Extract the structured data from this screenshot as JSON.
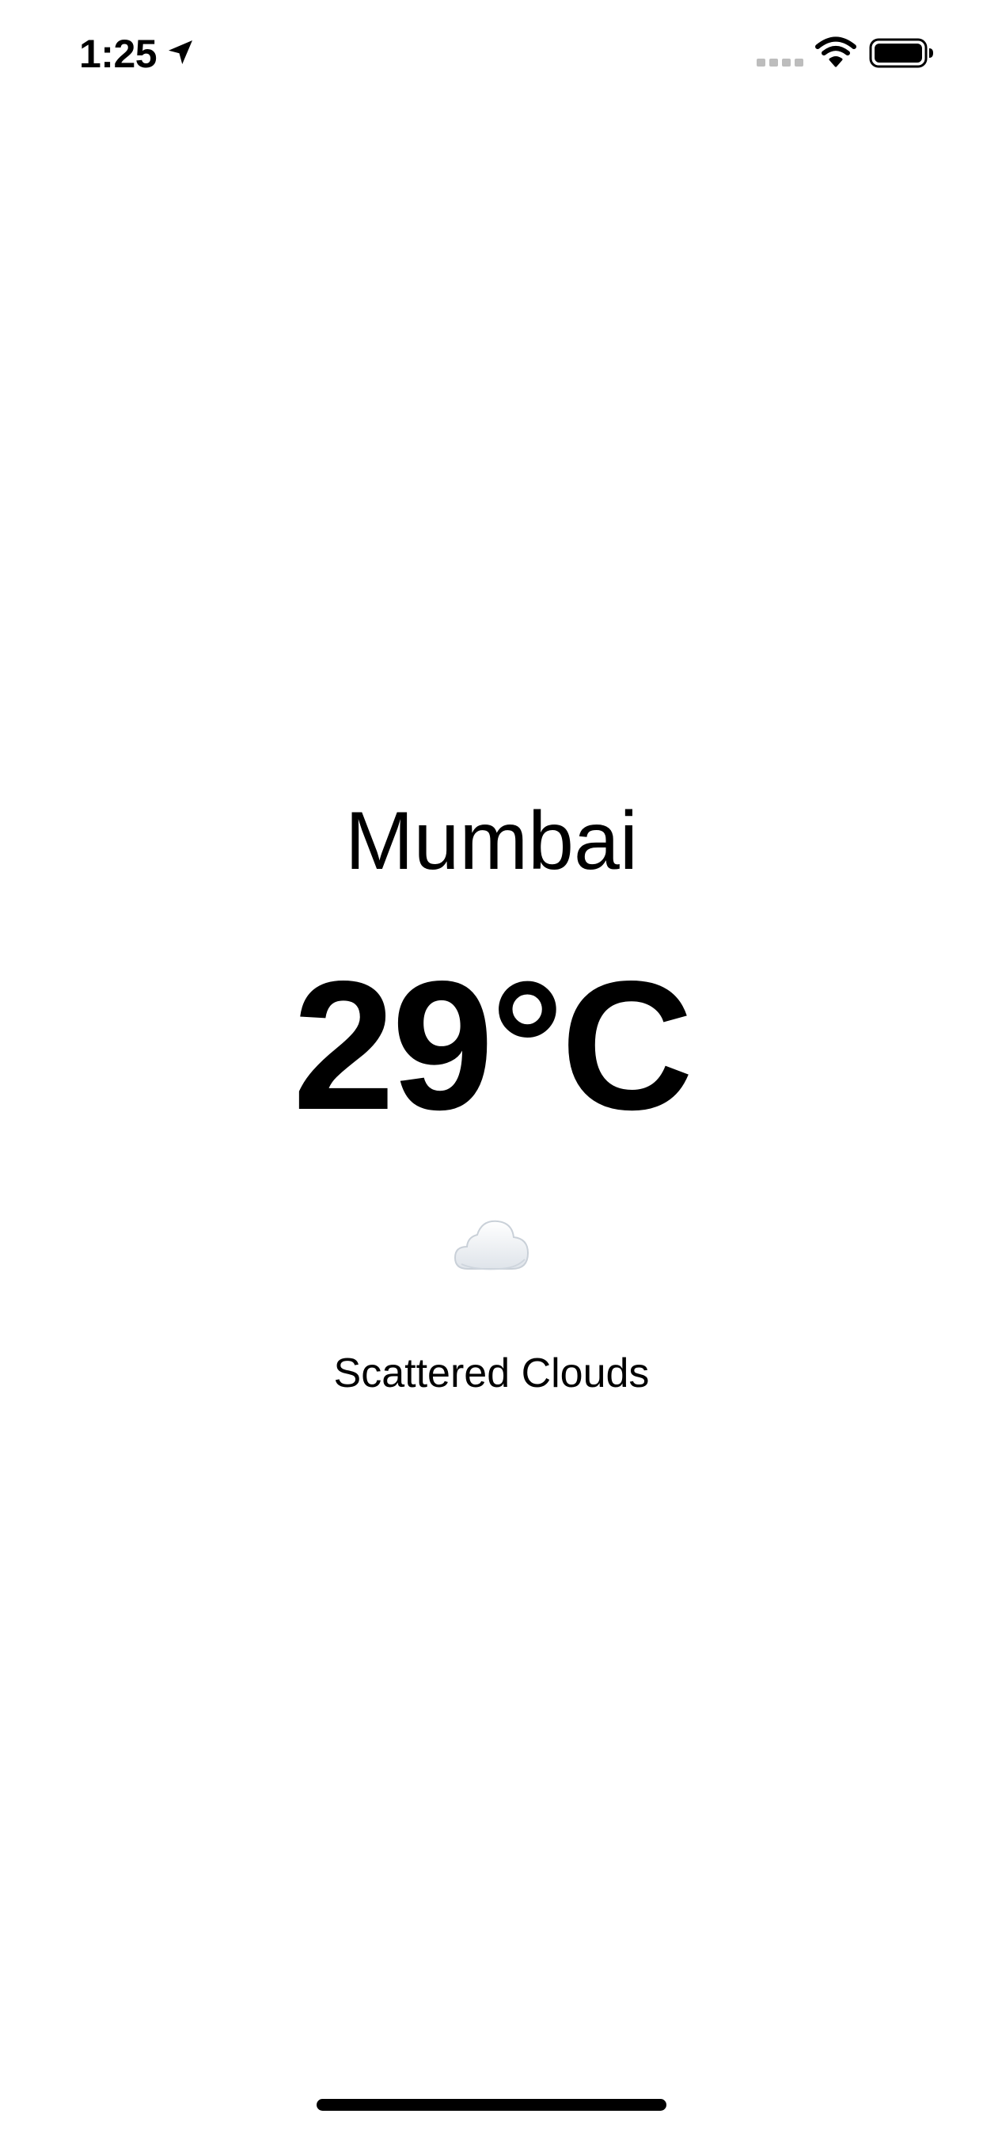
{
  "status_bar": {
    "time": "1:25",
    "location_icon": "location-arrow-icon",
    "signal_icon": "cellular-signal-icon",
    "wifi_icon": "wifi-icon",
    "battery_icon": "battery-icon"
  },
  "weather": {
    "city": "Mumbai",
    "temperature": "29°C",
    "condition_icon": "cloud-icon",
    "condition": "Scattered Clouds"
  },
  "colors": {
    "background": "#ffffff",
    "text": "#000000",
    "signal_inactive": "#bdbdbd"
  }
}
